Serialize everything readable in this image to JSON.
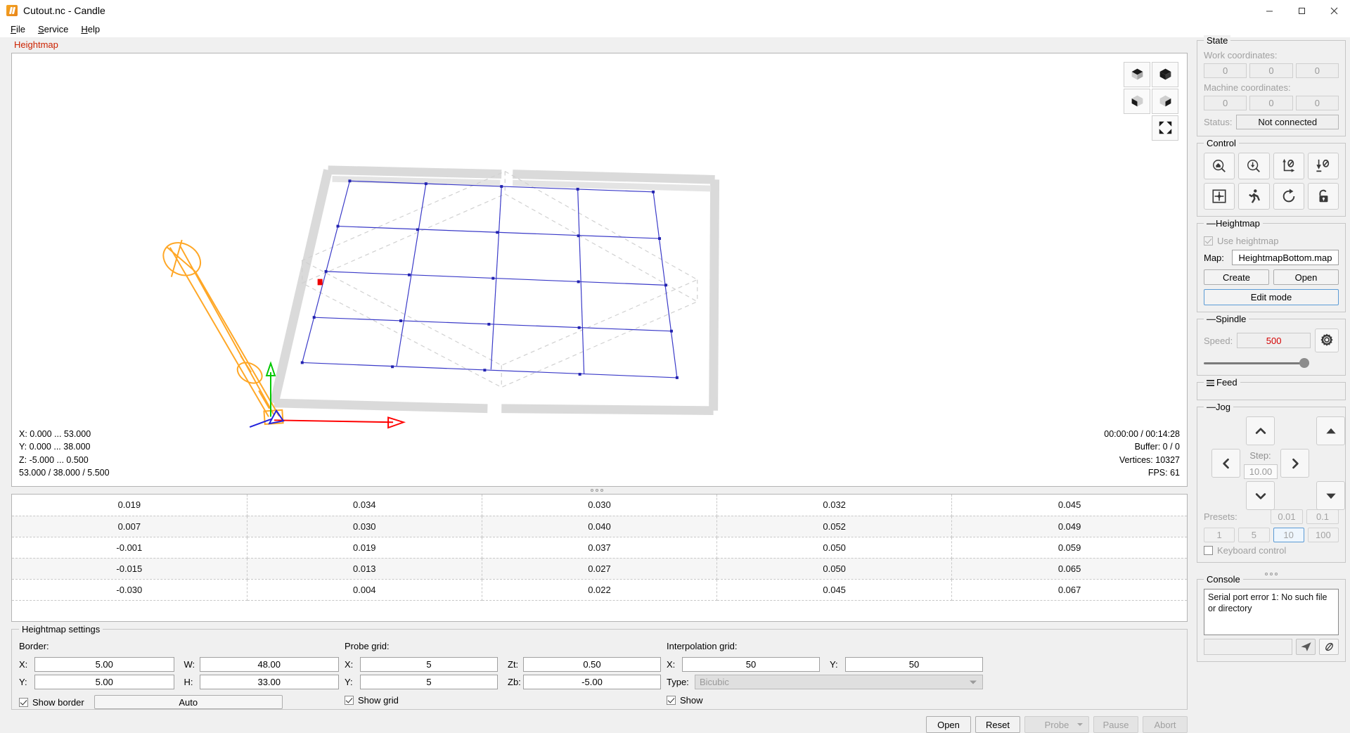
{
  "window": {
    "title": "Cutout.nc - Candle",
    "app_icon": "candle-icon",
    "minimize": "minimize-icon",
    "maximize": "maximize-icon",
    "close": "close-icon"
  },
  "menu": {
    "items": [
      {
        "label": "File",
        "mnemonic": "F"
      },
      {
        "label": "Service",
        "mnemonic": "S"
      },
      {
        "label": "Help",
        "mnemonic": "H"
      }
    ]
  },
  "tab": {
    "label": "Heightmap",
    "color": "#cc2200"
  },
  "viewport": {
    "toolbar": [
      {
        "name": "view-isometric-1-button",
        "icon": "cube-icon"
      },
      {
        "name": "view-isometric-2-button",
        "icon": "cube-icon"
      },
      {
        "name": "view-isometric-3-button",
        "icon": "cube-icon"
      },
      {
        "name": "view-isometric-4-button",
        "icon": "cube-icon"
      },
      {
        "name": "fit-to-screen-button",
        "icon": "expand-arrows-icon"
      }
    ],
    "info_left": "X: 0.000 ... 53.000\nY: 0.000 ... 38.000\nZ: -5.000 ... 0.500\n53.000 / 38.000 / 5.500",
    "info_right": "00:00:00 / 00:14:28\nBuffer: 0 / 0\nVertices: 10327\nFPS: 61",
    "x_range": "0.000 ... 53.000",
    "y_range": "0.000 ... 38.000",
    "z_range": "-5.000 ... 0.500",
    "dimensions": "53.000 / 38.000 / 5.500",
    "elapsed_total": "00:00:00 / 00:14:28",
    "buffer": "Buffer: 0 / 0",
    "vertices": "Vertices: 10327",
    "fps": "FPS: 61"
  },
  "heightmap_table": {
    "rows": [
      [
        "0.019",
        "0.034",
        "0.030",
        "0.032",
        "0.045"
      ],
      [
        "0.007",
        "0.030",
        "0.040",
        "0.052",
        "0.049"
      ],
      [
        "-0.001",
        "0.019",
        "0.037",
        "0.050",
        "0.059"
      ],
      [
        "-0.015",
        "0.013",
        "0.027",
        "0.050",
        "0.065"
      ],
      [
        "-0.030",
        "0.004",
        "0.022",
        "0.045",
        "0.067"
      ]
    ]
  },
  "settings": {
    "title": "Heightmap settings",
    "border": {
      "heading": "Border:",
      "x_label": "X:",
      "x_value": "5.00",
      "y_label": "Y:",
      "y_value": "5.00",
      "w_label": "W:",
      "w_value": "48.00",
      "h_label": "H:",
      "h_value": "33.00",
      "show_border_label": "Show border",
      "show_border_checked": true,
      "auto_label": "Auto"
    },
    "probe": {
      "heading": "Probe grid:",
      "x_label": "X:",
      "x_value": "5",
      "y_label": "Y:",
      "y_value": "5",
      "zt_label": "Zt:",
      "zt_value": "0.50",
      "zb_label": "Zb:",
      "zb_value": "-5.00",
      "show_grid_label": "Show grid",
      "show_grid_checked": true
    },
    "interpolation": {
      "heading": "Interpolation grid:",
      "x_label": "X:",
      "x_value": "50",
      "y_label": "Y:",
      "y_value": "50",
      "type_label": "Type:",
      "type_value": "Bicubic",
      "show_label": "Show",
      "show_checked": true
    }
  },
  "actions": {
    "open": "Open",
    "reset": "Reset",
    "probe": "Probe",
    "pause": "Pause",
    "abort": "Abort"
  },
  "state": {
    "title": "State",
    "work_coordinates_label": "Work coordinates:",
    "work_coordinates": [
      "0",
      "0",
      "0"
    ],
    "machine_coordinates_label": "Machine coordinates:",
    "machine_coordinates": [
      "0",
      "0",
      "0"
    ],
    "status_label": "Status:",
    "status_value": "Not connected"
  },
  "control": {
    "title": "Control",
    "buttons": [
      {
        "name": "home-button",
        "icon": "home-search-icon"
      },
      {
        "name": "probe-z-button",
        "icon": "down-search-icon"
      },
      {
        "name": "zero-xy-button",
        "icon": "axis-zero-icon"
      },
      {
        "name": "zero-z-button",
        "icon": "down-zero-icon"
      },
      {
        "name": "safe-position-button",
        "icon": "center-target-icon"
      },
      {
        "name": "run-button",
        "icon": "runner-icon"
      },
      {
        "name": "reset-button",
        "icon": "restore-circle-icon"
      },
      {
        "name": "unlock-button",
        "icon": "unlock-icon"
      }
    ]
  },
  "heightmap_panel": {
    "title": "Heightmap",
    "use_heightmap_label": "Use heightmap",
    "use_heightmap_checked": true,
    "use_heightmap_enabled": false,
    "map_label": "Map:",
    "map_value": "HeightmapBottom.map",
    "create_label": "Create",
    "open_label": "Open",
    "edit_mode_label": "Edit mode"
  },
  "spindle": {
    "title": "Spindle",
    "speed_label": "Speed:",
    "speed_value": "500",
    "speed_color": "#d40000",
    "gear_icon": "gear-icon",
    "slider_percent": 88
  },
  "feed": {
    "title": "Feed"
  },
  "jog": {
    "title": "Jog",
    "step_label": "Step:",
    "step_value": "10.00",
    "up_icon": "chevron-up-icon",
    "down_icon": "chevron-down-icon",
    "left_icon": "chevron-left-icon",
    "right_icon": "chevron-right-icon",
    "z_up_icon": "triangle-up-icon",
    "z_down_icon": "triangle-down-icon",
    "presets_label": "Presets:",
    "presets": [
      "0.01",
      "0.1",
      "1",
      "5",
      "10",
      "100"
    ],
    "active_preset": "10",
    "keyboard_control_label": "Keyboard control",
    "keyboard_control_checked": false
  },
  "console": {
    "title": "Console",
    "message": "Serial port error 1: No such file or directory",
    "input_placeholder": "",
    "send_icon": "send-icon",
    "clip_icon": "paperclip-icon"
  },
  "colors": {
    "accent": "#0078d7",
    "tab_red": "#cc2200",
    "spindle_red": "#d40000",
    "window_bg": "#f0f0f0",
    "panel_border": "#c6c6c6"
  }
}
